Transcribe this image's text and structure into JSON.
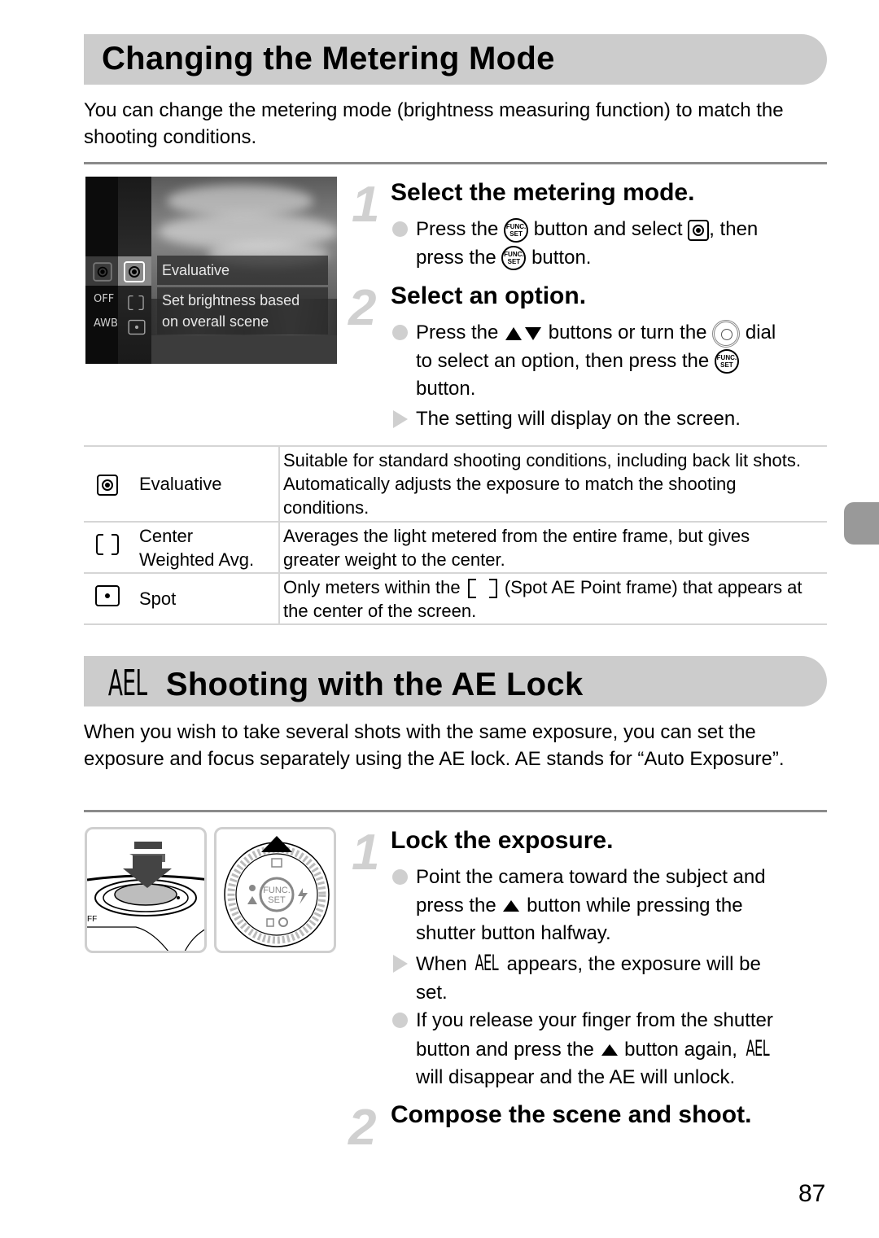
{
  "section1": {
    "title": "Changing the Metering Mode",
    "intro": "You can change the metering mode (brightness measuring function) to match the shooting conditions.",
    "screen": {
      "option_title": "Evaluative",
      "option_desc_line1": "Set brightness based",
      "option_desc_line2": "on overall scene",
      "left_icons": [
        "evaluative",
        "flash-off",
        "AWB",
        "auto"
      ],
      "left_icon_labels": {
        "flash_off": "OFF",
        "awb": "AWB"
      }
    },
    "steps": [
      {
        "number": "1",
        "title": "Select the metering mode.",
        "items": [
          {
            "type": "bullet",
            "parts": [
              "Press the",
              "func-set-icon",
              "button and select",
              "evaluative-icon",
              ", then press the",
              "func-set-icon",
              "button."
            ],
            "text_a": "Press the",
            "text_b": "button and select",
            "text_c": ", then",
            "text_d": "press the",
            "text_e": "button."
          }
        ]
      },
      {
        "number": "2",
        "title": "Select an option.",
        "items": [
          {
            "type": "bullet",
            "text_a": "Press the",
            "text_b": "buttons or turn the",
            "text_c": "dial",
            "text_d": "to select an option, then press the",
            "text_e": "button."
          },
          {
            "type": "result",
            "text": "The setting will display on the screen."
          }
        ]
      }
    ],
    "func_icon_text": {
      "line1": "FUNC.",
      "line2": "SET"
    },
    "table": [
      {
        "icon": "evaluative-metering-icon",
        "name": "Evaluative",
        "desc_lines": [
          "Suitable for standard shooting conditions, including back lit shots.",
          "Automatically adjusts the exposure to match the shooting",
          "conditions."
        ]
      },
      {
        "icon": "center-weighted-metering-icon",
        "name_lines": [
          "Center",
          "Weighted Avg."
        ],
        "desc_lines": [
          "Averages the light metered from the entire frame, but gives",
          "greater weight to the center."
        ]
      },
      {
        "icon": "spot-metering-icon",
        "name": "Spot",
        "desc_a": "Only meters within the",
        "desc_b": "(Spot AE Point frame) that appears at",
        "desc_c": "the center of the screen."
      }
    ]
  },
  "section2": {
    "title_icon": "AEL",
    "title": "Shooting with the AE Lock",
    "intro": "When you wish to take several shots with the same exposure, you can set the exposure and focus separately using the AE lock. AE stands for “Auto Exposure”.",
    "illustration_labels": {
      "func": "FUNC.",
      "set": "SET",
      "off": "FF"
    },
    "steps": [
      {
        "number": "1",
        "title": "Lock the exposure.",
        "items": [
          {
            "type": "bullet",
            "text_a": "Point the camera toward the subject and",
            "text_b": "press the",
            "text_c": "button while pressing the",
            "text_d": "shutter button halfway."
          },
          {
            "type": "result",
            "text_a": "When",
            "ael": "AEL",
            "text_b": "appears, the exposure will be",
            "text_c": "set."
          },
          {
            "type": "bullet",
            "text_a": "If you release your finger from the shutter",
            "text_b": "button and press the",
            "text_c": "button again,",
            "ael": "AEL",
            "text_d": "will disappear and the AE will unlock."
          }
        ]
      },
      {
        "number": "2",
        "title": "Compose the scene and shoot."
      }
    ]
  },
  "page_number": "87",
  "colors": {
    "header_bar": "#cccccc",
    "rule": "#8a8a8a",
    "step_number": "#d0d0d0",
    "bullet": "#cfcfcf",
    "side_tab": "#999999"
  }
}
